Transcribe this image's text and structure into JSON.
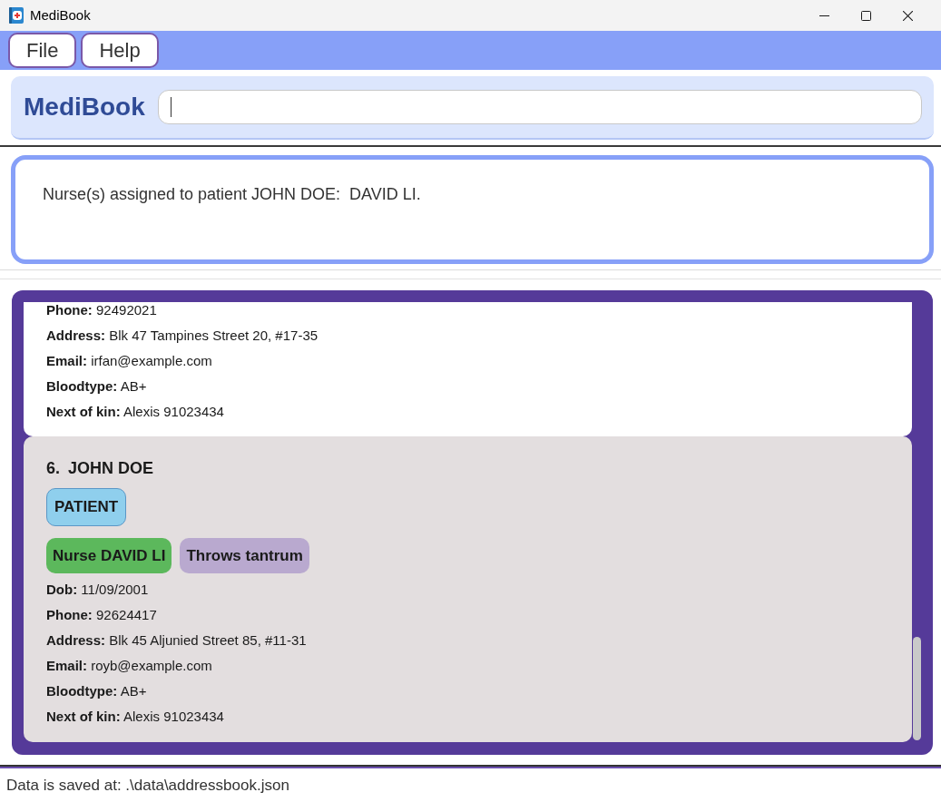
{
  "window": {
    "title": "MediBook"
  },
  "menu": [
    {
      "label": "File"
    },
    {
      "label": "Help"
    }
  ],
  "header": {
    "title": "MediBook",
    "command_box": {
      "focused": true
    }
  },
  "result_display": {
    "message": "Nurse(s) assigned to patient JOHN DOE:  DAVID LI."
  },
  "person_list": {
    "cards": [
      {
        "selected": false,
        "details": [
          "**Phone:** 92492021",
          "**Address:** Blk 47 Tampines Street 20, #17-35",
          "**Email:** irfan@example.com",
          "**Bloodtype:** AB+",
          "**Next of kin:** Alexis 91023434"
        ]
      },
      {
        "selected": true,
        "index": "6.",
        "name": "JOHN DOE",
        "role": "PATIENT",
        "tags": [
          {
            "label": "Nurse DAVID LI",
            "color": "#5cb85c"
          },
          {
            "label": "Throws tantrum",
            "color": "#b9a9cf"
          }
        ],
        "details": [
          "**Dob:** 11/09/2001",
          "**Phone:** 92624417",
          "**Address:** Blk 45 Aljunied Street 85, #11-31",
          "**Email:** royb@example.com",
          "**Bloodtype:** AB+",
          "**Next of kin:** Alexis 91023434"
        ]
      }
    ]
  },
  "status_bar": {
    "text": "Data is saved at: .\\data\\addressbook.json"
  }
}
